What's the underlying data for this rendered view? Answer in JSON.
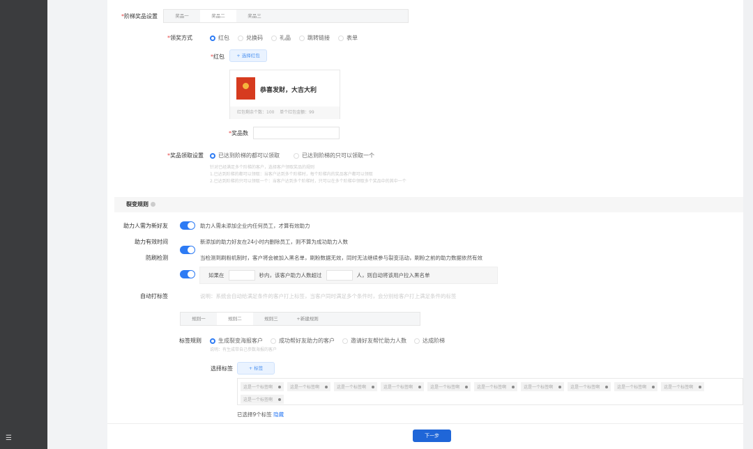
{
  "sidebar": {
    "menu_icon": "menu-collapse-icon",
    "menu_glyph": "☰"
  },
  "prize": {
    "label": "阶梯奖品设置",
    "tabs": [
      "奖品一",
      "奖品二",
      "奖品三"
    ],
    "active_tab": 1,
    "method_label": "领奖方式",
    "methods": [
      "红包",
      "兑换码",
      "礼品",
      "跳转链接",
      "表单"
    ],
    "method_selected": 0,
    "redpacket_label": "红包",
    "select_redpacket": "+ 选择红包",
    "card": {
      "title": "恭喜发财，大吉大利",
      "remaining": "红包剩余个数：100",
      "amount": "单个红包金额：99"
    },
    "count_label": "奖品数",
    "count_value": "",
    "claim_label": "奖品领取设置",
    "claim_options": [
      "已达到阶梯的都可以领取",
      "已达到阶梯的只可以领取一个"
    ],
    "claim_selected": 0,
    "claim_hints": [
      "针对已经满足多个阶梯的客户，选择客户领取奖品的规则",
      "1.已达到阶梯的都可以领取：当客户达到多个阶梯时，每个阶梯内的奖品客户都可以领取",
      "2.已达到阶梯的只可以领取一个：当客户达到多个阶梯时，只可以在多个阶梯中领取多个奖品中的其中一个"
    ]
  },
  "fission": {
    "title": "裂变规则",
    "rows": [
      {
        "label": "助力人需为新好友",
        "desc": "助力人需未添加企业内任何员工，才算有效助力",
        "on": true
      },
      {
        "label": "助力有效时间",
        "desc": "新添加的助力好友在24小时内删除员工，则不算为成功助力人数",
        "on": true
      },
      {
        "label": "防刷检测",
        "desc": "当检测到刷粉机制时，客户将会被加入黑名单，刷粉数据无效，同时无法继续参与裂变活动，刷粉之前的助力数据依然有效",
        "on": true
      }
    ],
    "anti": {
      "prefix": "如果在",
      "mid": "秒内，该客户助力人数超过",
      "suffix": "人，则自动将该用户拉入黑名单",
      "seconds": "",
      "people": ""
    },
    "autotag": {
      "label": "自动打标签",
      "on": true,
      "desc": "说明：系统会自动给满足条件的客户打上标签，当客户同时满足多个条件时，会分别给客户打上满足条件的标签"
    },
    "rule_tabs": [
      "规则一",
      "规则二",
      "规则三",
      "+新建规则"
    ],
    "rule_active": 1,
    "tag_rule_label": "标签规则",
    "tag_rules": [
      "生成裂变海报客户",
      "成功帮好友助力的客户",
      "邀请好友帮忙助力人数",
      "达成阶梯"
    ],
    "tag_rule_selected": 0,
    "tag_rule_hint": "说明：有生成带自己参数海报的客户",
    "select_tag_label": "选择标签",
    "add_tag": "+ 标签",
    "tags": [
      "这是一个标签啊",
      "这是一个标签啊",
      "这是一个标签啊",
      "这是一个标签啊",
      "这是一个标签啊",
      "这是一个标签啊",
      "这是一个标签啊",
      "这是一个标签啊",
      "这是一个标签啊",
      "这是一个标签啊",
      "这是一个标签啊"
    ],
    "selected_text": "已选择9个标签",
    "hide_link": "隐藏"
  },
  "footer": {
    "next": "下一步"
  }
}
